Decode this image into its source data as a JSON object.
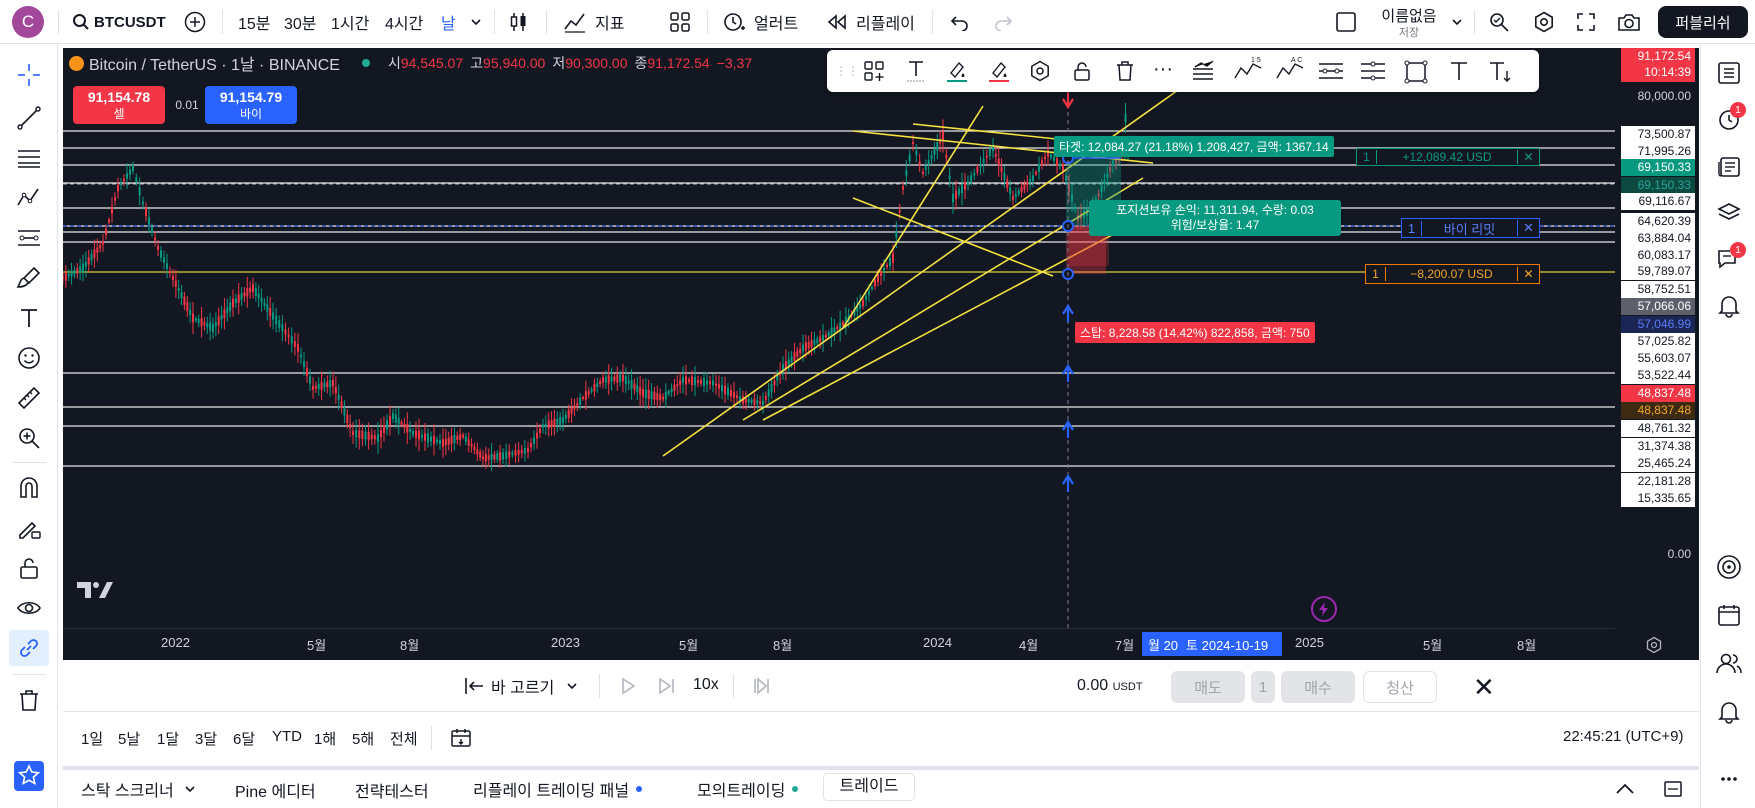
{
  "topbar": {
    "avatar": "C",
    "symbol": "BTCUSDT",
    "intervals": [
      "15분",
      "30분",
      "1시간",
      "4시간",
      "날"
    ],
    "indicators": "지표",
    "alert": "얼러트",
    "replay": "리플레이",
    "layout_name": "이름없음",
    "layout_save": "저장",
    "publish": "퍼블리쉬"
  },
  "legend": {
    "title": "Bitcoin / TetherUS · 1날 · BINANCE",
    "o_label": "시",
    "o": "94,545.07",
    "h_label": "고",
    "h": "95,940.00",
    "l_label": "저",
    "l": "90,300.00",
    "c_label": "종",
    "c": "91,172.54",
    "chg": "−3,37"
  },
  "trade": {
    "sell_price": "91,154.78",
    "sell_label": "셀",
    "spread": "0.01",
    "buy_price": "91,154.79",
    "buy_label": "바이"
  },
  "position": {
    "target_label": "타겟: 12,084.27 (21.18%) 1,208,427, 금액: 1367.14",
    "open_pl": "포지션보유 손익: 11,311.94, 수량: 0.03",
    "risk_reward": "위험/보상율: 1.47",
    "stop_label": "스탑: 8,228.58 (14.42%) 822,858, 금액: 750"
  },
  "orders": {
    "tp_qty": "1",
    "tp_text": "+12,089.42 USD",
    "limit_qty": "1",
    "limit_text": "바이 리밋",
    "sl_qty": "1",
    "sl_text": "−8,200.07 USD",
    "close": "✕"
  },
  "price_labels": [
    {
      "text": "80,000.00",
      "style": "plain"
    },
    {
      "text": "73,500.87",
      "style": "white"
    },
    {
      "text": "71,995.26",
      "style": "white"
    },
    {
      "text": "69,150.33",
      "style": "green"
    },
    {
      "text": "69,150.33",
      "style": "dgreen"
    },
    {
      "text": "69,116.67",
      "style": "white"
    },
    {
      "text": "64,620.39",
      "style": "white"
    },
    {
      "text": "63,884.04",
      "style": "white"
    },
    {
      "text": "60,083.17",
      "style": "white"
    },
    {
      "text": "59,789.07",
      "style": "white"
    },
    {
      "text": "58,752.51",
      "style": "white"
    },
    {
      "text": "57,066.06",
      "style": "gray"
    },
    {
      "text": "57,046.99",
      "style": "navy"
    },
    {
      "text": "57,025.82",
      "style": "white"
    },
    {
      "text": "55,603.07",
      "style": "white"
    },
    {
      "text": "53,522.44",
      "style": "white"
    },
    {
      "text": "48,837.48",
      "style": "red"
    },
    {
      "text": "48,837.48",
      "style": "dorange"
    },
    {
      "text": "48,761.32",
      "style": "white"
    },
    {
      "text": "31,374.38",
      "style": "white"
    },
    {
      "text": "25,465.24",
      "style": "white"
    },
    {
      "text": "22,181.28",
      "style": "white"
    },
    {
      "text": "15,335.65",
      "style": "white"
    },
    {
      "text": "0.00",
      "style": "plain"
    }
  ],
  "last_price": {
    "price": "91,172.54",
    "countdown": "10:14:39"
  },
  "time_axis": [
    "2022",
    "5월",
    "8월",
    "2023",
    "5월",
    "8월",
    "2024",
    "4월",
    "7월",
    "2025",
    "5월",
    "8월"
  ],
  "crosshair_time": "토 2024-10-19",
  "partial_label": "월 20",
  "replay": {
    "pick_bar": "바 고르기",
    "speed": "10x",
    "balance": "0.00",
    "currency": "USDT",
    "sell": "매도",
    "qty": "1",
    "buy": "매수",
    "flatten": "청산",
    "close": "✕"
  },
  "ranges": [
    "1일",
    "5날",
    "1달",
    "3달",
    "6달",
    "YTD",
    "1해",
    "5해",
    "전체"
  ],
  "clock": "22:45:21 (UTC+9)",
  "bottom_tabs": [
    {
      "label": "스탁 스크리너",
      "dot": ""
    },
    {
      "label": "Pine 에디터",
      "dot": ""
    },
    {
      "label": "전략테스터",
      "dot": ""
    },
    {
      "label": "리플레이 트레이딩 패널",
      "dot": "#2962ff"
    },
    {
      "label": "모의트레이딩",
      "dot": "#22ab94"
    },
    {
      "label": "트레이드",
      "dot": ""
    }
  ],
  "badges": {
    "alerts": "1",
    "chats": "1"
  },
  "colors": {
    "bg": "#131722",
    "up": "#089981",
    "down": "#f23645",
    "trend": "#f5e23f",
    "accent": "#2962ff",
    "target": "#089981"
  },
  "icons": [
    "search-icon",
    "plus-icon",
    "chevron-down-icon",
    "candles-icon",
    "indicators-icon",
    "layout-grid-icon",
    "alert-clock-icon",
    "replay-icon",
    "undo-icon",
    "redo-icon",
    "square-icon",
    "magnifier-icon",
    "gear-icon",
    "fullscreen-icon",
    "camera-icon"
  ]
}
